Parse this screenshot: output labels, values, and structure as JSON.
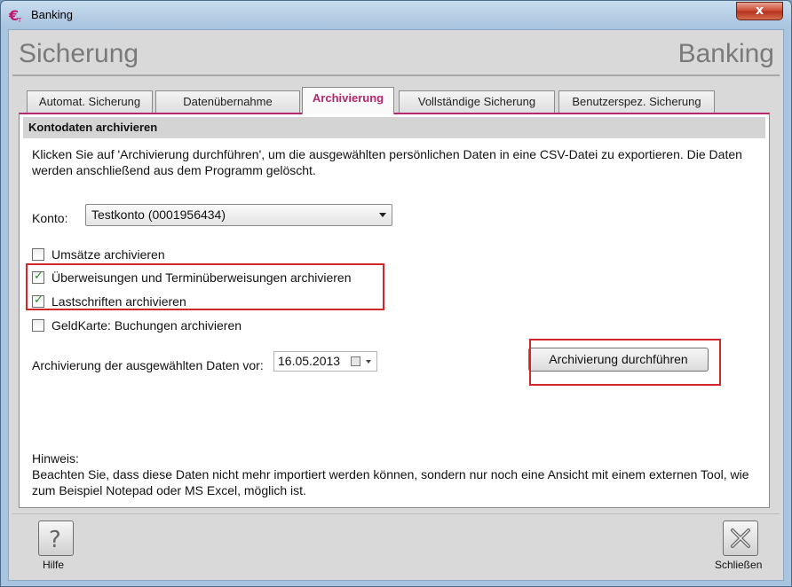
{
  "window": {
    "title": "Banking",
    "close_glyph": "x"
  },
  "header": {
    "left": "Sicherung",
    "right": "Banking"
  },
  "tabs": [
    {
      "label": "Automat. Sicherung",
      "active": false
    },
    {
      "label": "Datenübernahme",
      "active": false
    },
    {
      "label": "Archivierung",
      "active": true
    },
    {
      "label": "Vollständige Sicherung",
      "active": false
    },
    {
      "label": "Benutzerspez. Sicherung",
      "active": false
    }
  ],
  "section": {
    "title": "Kontodaten archivieren",
    "intro": "Klicken Sie auf 'Archivierung durchführen', um die ausgewählten persönlichen Daten in eine CSV-Datei zu exportieren. Die Daten werden anschließend aus dem Programm gelöscht."
  },
  "konto": {
    "label": "Konto:",
    "selected": "Testkonto (0001956434)"
  },
  "checkboxes": [
    {
      "label": "Umsätze archivieren",
      "checked": false
    },
    {
      "label": "Überweisungen und Terminüberweisungen archivieren",
      "checked": true
    },
    {
      "label": "Lastschriften archivieren",
      "checked": true
    },
    {
      "label": "GeldKarte: Buchungen archivieren",
      "checked": false
    }
  ],
  "date": {
    "label": "Archivierung der ausgewählten Daten vor:",
    "value": "16.05.2013"
  },
  "action_button": "Archivierung durchführen",
  "hint": {
    "title": "Hinweis:",
    "text": "Beachten Sie, dass diese Daten nicht mehr importiert werden können, sondern nur noch eine Ansicht mit einem externen Tool, wie zum Beispiel Notepad oder MS Excel, möglich ist."
  },
  "footer": {
    "help_label": "Hilfe",
    "close_label": "Schließen"
  },
  "colors": {
    "accent": "#b7276f",
    "highlight_box": "#d2262b",
    "check": "#2a8a2a"
  },
  "icons": {
    "app": "euro-icon",
    "help": "question-icon",
    "close": "x-icon"
  }
}
